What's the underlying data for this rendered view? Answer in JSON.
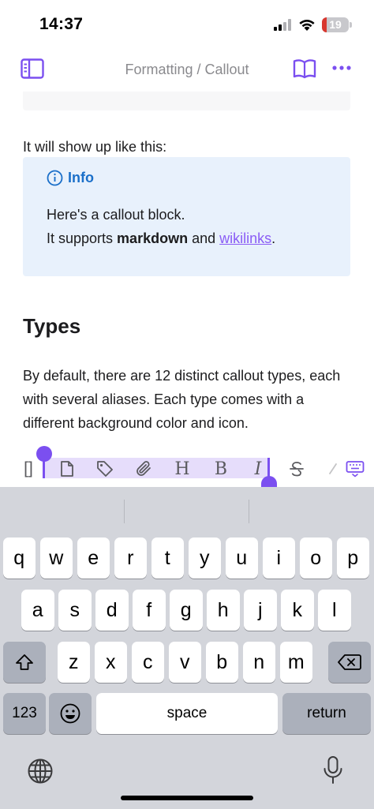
{
  "status": {
    "time": "14:37",
    "battery": "19",
    "battery_level": 0.19,
    "battery_color": "#d8372f"
  },
  "nav": {
    "crumb_parent": "Formatting",
    "crumb_sep": " / ",
    "crumb_current": "Callout"
  },
  "content": {
    "intro": "It will show up like this:",
    "callout": {
      "title": "Info",
      "line1": "Here's a callout block.",
      "line2_a": "It supports ",
      "line2_bold": "markdown",
      "line2_b": " and ",
      "line2_link": "wikilinks",
      "line2_end": "."
    },
    "heading": "Types",
    "paragraph": "By default, there are 12 distinct callout types, each with several aliases. Each type comes with a different background color and icon."
  },
  "toolbar": {
    "bracket": "[]",
    "heading": "H",
    "bold": "B",
    "italic": "I"
  },
  "keyboard": {
    "row1": [
      "q",
      "w",
      "e",
      "r",
      "t",
      "y",
      "u",
      "i",
      "o",
      "p"
    ],
    "row2": [
      "a",
      "s",
      "d",
      "f",
      "g",
      "h",
      "j",
      "k",
      "l"
    ],
    "row3": [
      "z",
      "x",
      "c",
      "v",
      "b",
      "n",
      "m"
    ],
    "numbers": "123",
    "space": "space",
    "return": "return"
  },
  "colors": {
    "accent": "#7b4ff0",
    "callout_bg": "#e8f1fc",
    "callout_title": "#1a6fc9"
  }
}
